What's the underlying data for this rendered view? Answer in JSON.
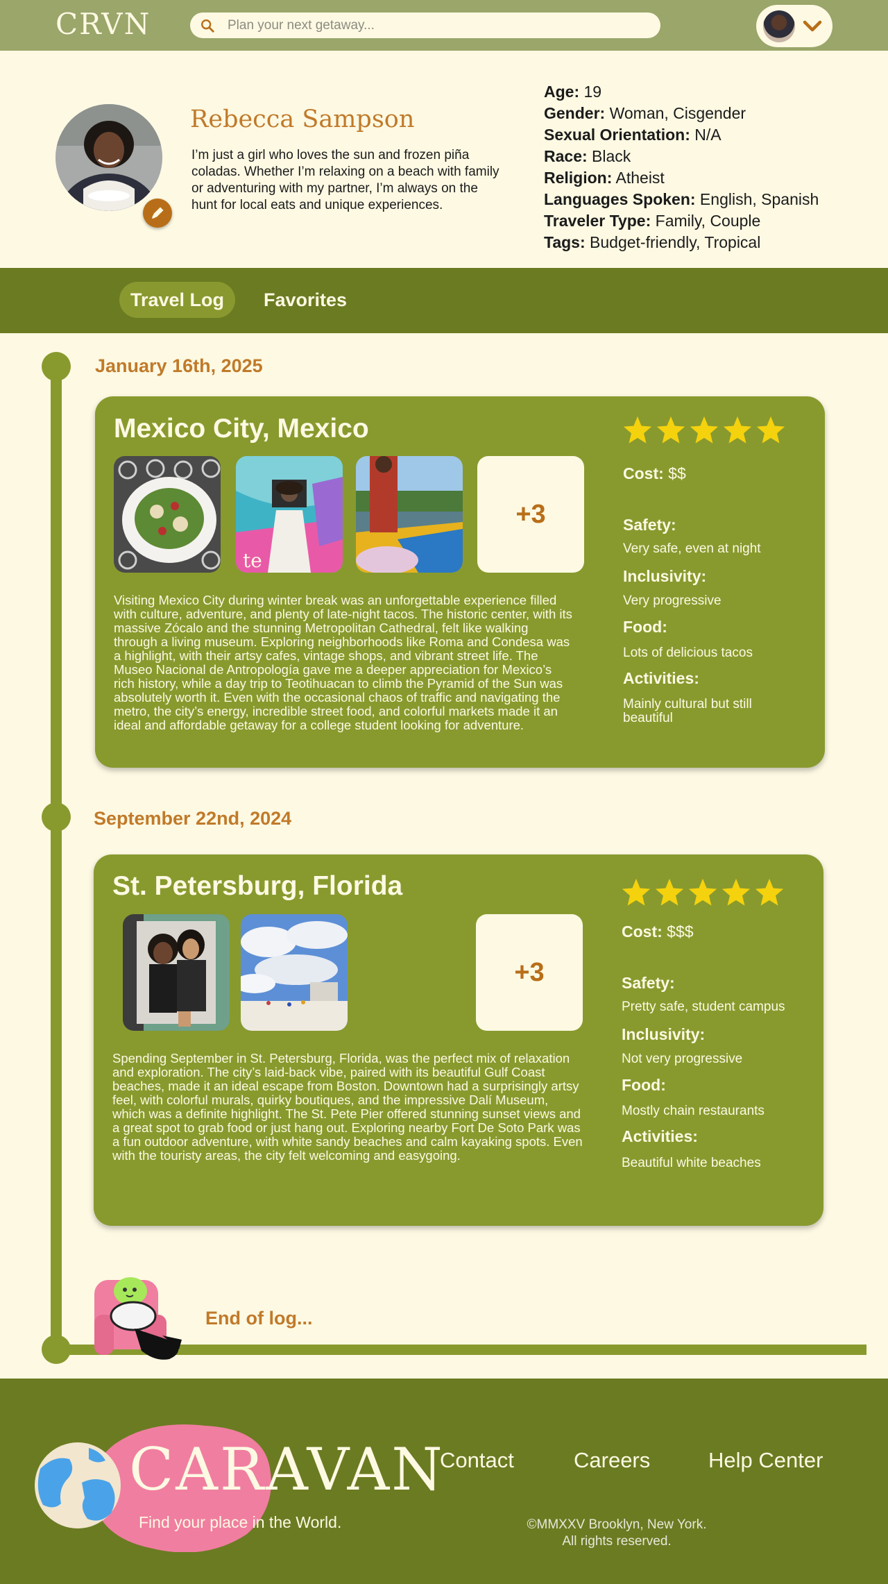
{
  "header": {
    "logo": "CRVN",
    "search_placeholder": "Plan your next getaway..."
  },
  "profile": {
    "name": "Rebecca Sampson",
    "bio": "I’m just a girl who loves the sun and frozen piña coladas. Whether I’m relaxing on a beach with family or adventuring with my partner, I’m always on the hunt for local eats and unique experiences.",
    "facts": [
      {
        "label": "Age:",
        "value": " 19"
      },
      {
        "label": "Gender:",
        "value": " Woman, Cisgender"
      },
      {
        "label": "Sexual Orientation:",
        "value": " N/A"
      },
      {
        "label": "Race:",
        "value": " Black"
      },
      {
        "label": "Religion:",
        "value": " Atheist"
      },
      {
        "label": "Languages Spoken:",
        "value": " English, Spanish"
      },
      {
        "label": "Traveler Type:",
        "value": " Family, Couple"
      },
      {
        "label": "Tags:",
        "value": " Budget-friendly, Tropical"
      }
    ]
  },
  "tabs": [
    {
      "label": "Travel Log",
      "active": true
    },
    {
      "label": "Favorites",
      "active": false
    }
  ],
  "entries": [
    {
      "date": "January 16th, 2025",
      "title": "Mexico City, Mexico",
      "more": "+3",
      "rating": 5,
      "cost_label": "Cost:",
      "cost": "$$",
      "safety_label": "Safety:",
      "safety": "Very safe, even at night",
      "inclusivity_label": "Inclusivity:",
      "inclusivity": "Very progressive",
      "food_label": "Food:",
      "food": "Lots of delicious tacos",
      "activities_label": "Activities:",
      "activities": "Mainly cultural but still beautiful",
      "text": "Visiting Mexico City during winter break was an unforgettable experience filled with culture, adventure, and plenty of late-night tacos. The historic center, with its massive Zócalo and the stunning Metropolitan Cathedral, felt like walking through a living museum. Exploring neighborhoods like Roma and Condesa was a highlight, with their artsy cafes, vintage shops, and vibrant street life. The Museo Nacional de Antropología gave me a deeper appreciation for Mexico’s rich history, while a day trip to Teotihuacan to climb the Pyramid of the Sun was absolutely worth it. Even with the occasional chaos of traffic and navigating the metro, the city’s energy, incredible street food, and colorful markets made it an ideal and affordable getaway for a college student looking for adventure."
    },
    {
      "date": "September 22nd, 2024",
      "title": "St. Petersburg, Florida",
      "more": "+3",
      "rating": 5,
      "cost_label": "Cost:",
      "cost": "$$$",
      "safety_label": "Safety:",
      "safety": "Pretty safe, student campus",
      "inclusivity_label": "Inclusivity:",
      "inclusivity": "Not very progressive",
      "food_label": "Food:",
      "food": "Mostly chain restaurants",
      "activities_label": "Activities:",
      "activities": "Beautiful white beaches",
      "text": "Spending September in St. Petersburg, Florida, was the perfect mix of relaxation and exploration. The city’s laid-back vibe, paired with its beautiful Gulf Coast beaches, made it an ideal escape from Boston. Downtown had a surprisingly artsy feel, with colorful murals, quirky boutiques, and the impressive Dalí Museum, which was a definite highlight. The St. Pete Pier offered stunning sunset views and a great spot to grab food or just hang out. Exploring nearby Fort De Soto Park was a fun outdoor adventure, with white sandy beaches and calm kayaking spots. Even with the touristy areas, the city felt welcoming and easygoing."
    }
  ],
  "end_text": "End of log...",
  "footer": {
    "logo": "CARAVAN",
    "tagline": "Find your place in the World.",
    "links": [
      "Contact",
      "Careers",
      "Help Center"
    ],
    "copyright_line1": "©MMXXV Brooklyn, New York.",
    "copyright_line2": "All rights reserved."
  },
  "colors": {
    "header_bg": "#9aa66a",
    "cream": "#fdf9e3",
    "olive_dark": "#6b7b22",
    "card_olive": "#889a2e",
    "accent_orange": "#c07a2a",
    "star_yellow": "#f5d20e",
    "pink": "#f07ea0"
  }
}
